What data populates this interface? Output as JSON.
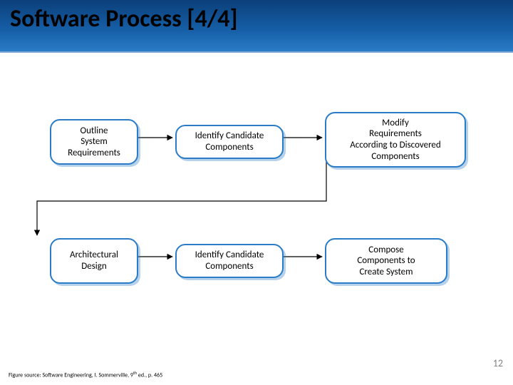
{
  "slide": {
    "title": "Software Process [4/4]",
    "page_number": "12",
    "figure_source_prefix": "Figure source: Software Engineering, I. Sommerville, 9",
    "figure_source_sup": "th",
    "figure_source_suffix": " ed., p. 465"
  },
  "diagram": {
    "nodes": {
      "n1": "Outline\nSystem\nRequirements",
      "n2": "Identify Candidate\nComponents",
      "n3": "Modify\nRequirements\nAccording to Discovered\nComponents",
      "n4": "Architectural\nDesign",
      "n5": "Identify Candidate\nComponents",
      "n6": "Compose\nComponents to\nCreate System"
    }
  },
  "colors": {
    "node_border": "#2a7cc6",
    "title_bg_top": "#0b3f7a",
    "title_bg_bottom": "#2a7cc6"
  }
}
